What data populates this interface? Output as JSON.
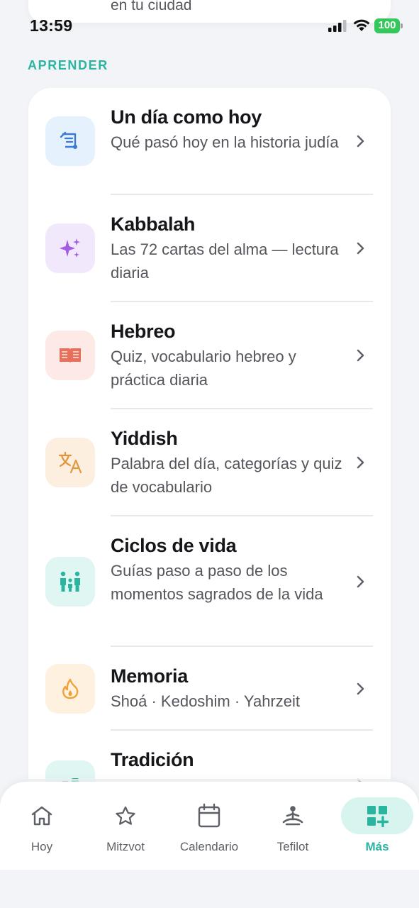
{
  "status_bar": {
    "time": "13:59",
    "battery": "100"
  },
  "top_card": {
    "partial_text": "en tu ciudad"
  },
  "section": {
    "label": "APRENDER"
  },
  "items": [
    {
      "title": "Un día como hoy",
      "subtitle": "Qué pasó hoy en la historia judía",
      "icon": "history-scroll-icon",
      "color": "#3a7bd5",
      "bg": "#e6f1fe"
    },
    {
      "title": "Kabbalah",
      "subtitle": "Las 72 cartas del alma — lectura diaria",
      "icon": "sparkles-icon",
      "color": "#a45de0",
      "bg": "#f1e8fc"
    },
    {
      "title": "Hebreo",
      "subtitle": "Quiz, vocabulario hebreo y práctica diaria",
      "icon": "book-open-icon",
      "color": "#ea6f5a",
      "bg": "#fdeae7"
    },
    {
      "title": "Yiddish",
      "subtitle": "Palabra del día, categorías y quiz de vocabulario",
      "icon": "translate-icon",
      "color": "#e3953b",
      "bg": "#fcefdf"
    },
    {
      "title": "Ciclos de vida",
      "subtitle": "Guías paso a paso de los momentos sagrados de la vida",
      "icon": "family-icon",
      "color": "#2bb5a0",
      "bg": "#e0f6f2"
    },
    {
      "title": "Memoria",
      "subtitle": "Shoá · Kedoshim · Yahrzeit",
      "icon": "flame-icon",
      "color": "#f0a23a",
      "bg": "#fef1e0"
    },
    {
      "title": "Tradición",
      "subtitle": "",
      "icon": "tradition-icon",
      "color": "#2bb5a0",
      "bg": "#e0f6f2"
    }
  ],
  "tabbar": {
    "tabs": [
      {
        "label": "Hoy",
        "icon": "home-icon"
      },
      {
        "label": "Mitzvot",
        "icon": "star-icon"
      },
      {
        "label": "Calendario",
        "icon": "calendar-icon"
      },
      {
        "label": "Tefilot",
        "icon": "prayer-person-icon"
      },
      {
        "label": "Más",
        "icon": "grid-plus-icon",
        "active": true
      }
    ],
    "active_color": "#2bb5a0"
  }
}
